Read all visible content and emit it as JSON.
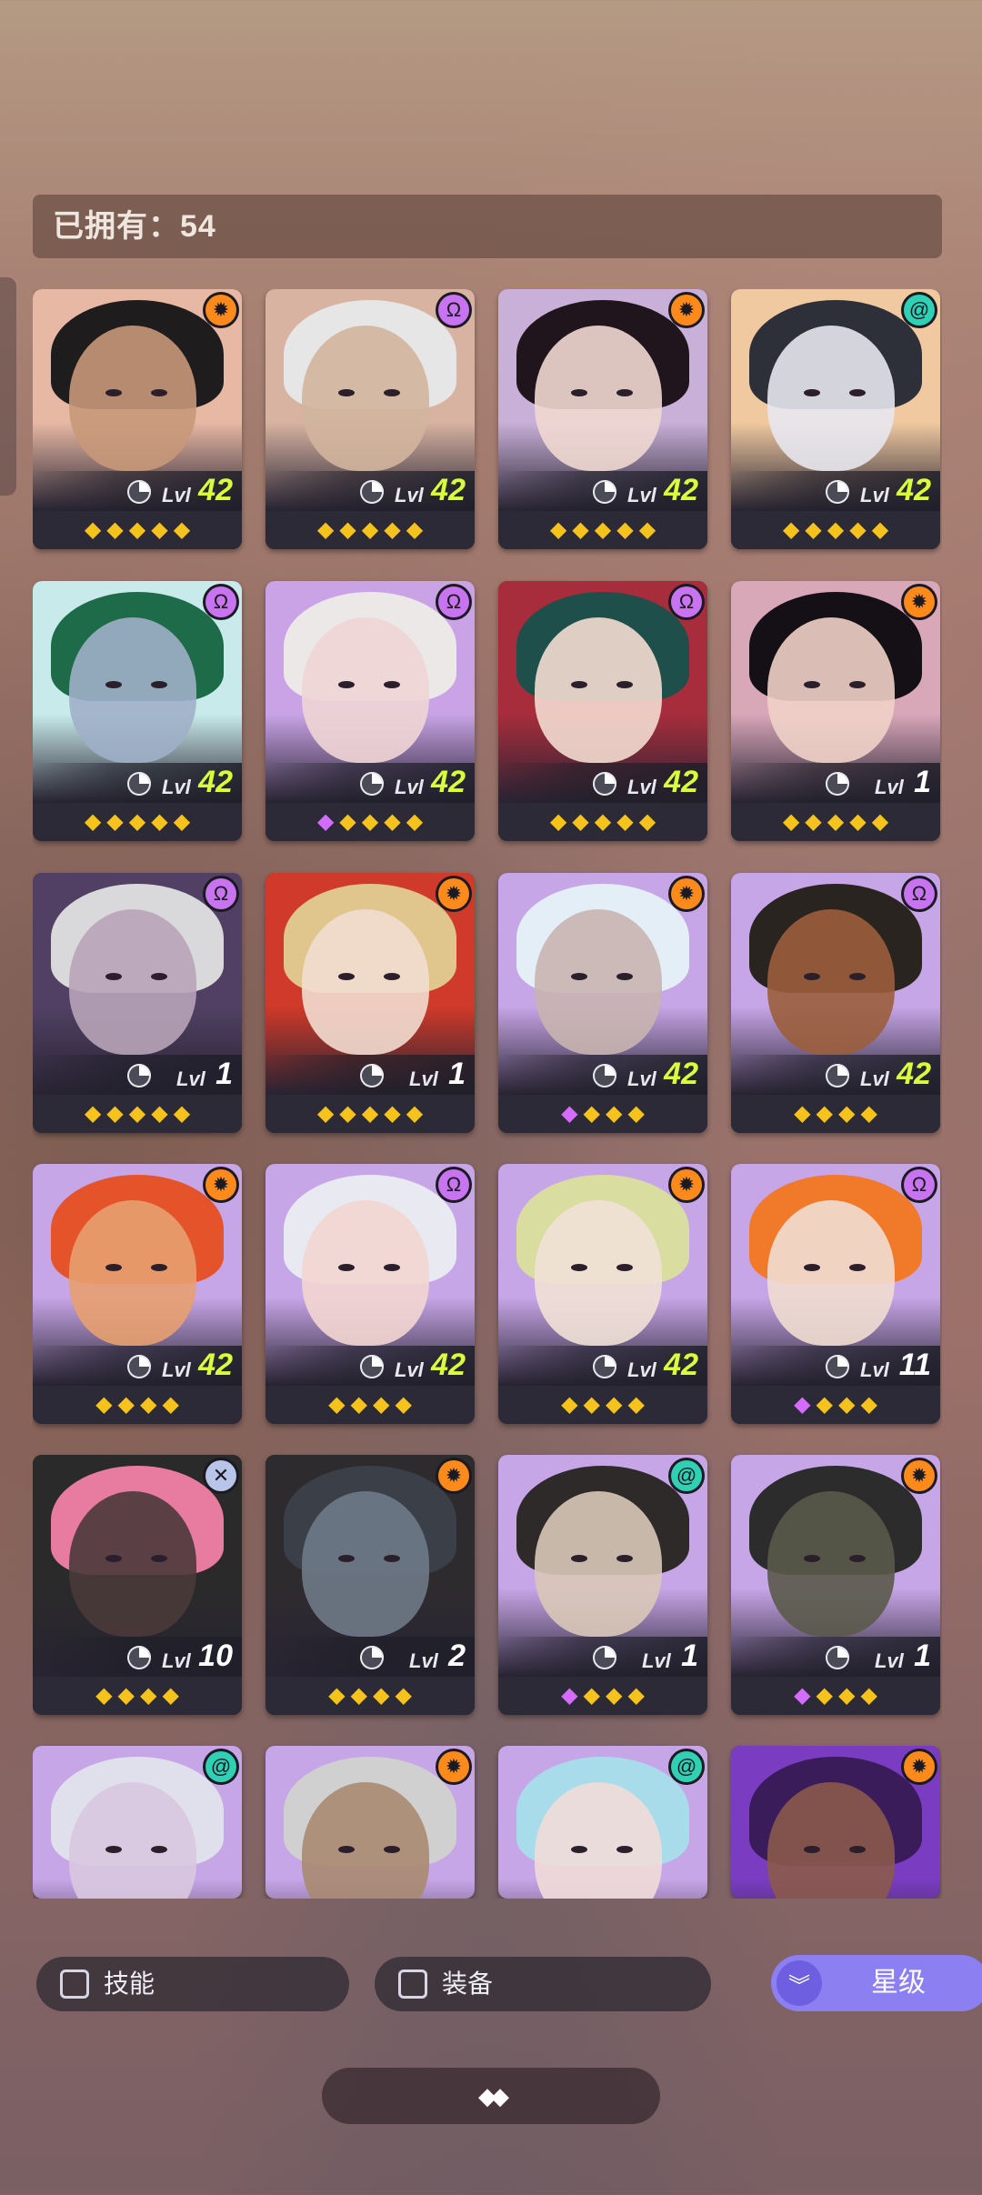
{
  "owned": {
    "label": "已拥有：54"
  },
  "level_prefix": "Lvl",
  "cards": [
    {
      "element": "orange",
      "level": "42",
      "stars": 5,
      "purple_stars": 0,
      "bg": "#e7b8a4",
      "hair": "#1f1c1e",
      "skin": "#c89879"
    },
    {
      "element": "purple",
      "level": "42",
      "stars": 5,
      "purple_stars": 0,
      "bg": "#d8b3a2",
      "hair": "#e6e6e6",
      "skin": "#d2b59d"
    },
    {
      "element": "orange",
      "level": "42",
      "stars": 5,
      "purple_stars": 0,
      "bg": "#c9b0d8",
      "hair": "#20151c",
      "skin": "#f0d8d0"
    },
    {
      "element": "teal",
      "level": "42",
      "stars": 5,
      "purple_stars": 0,
      "bg": "#f0c9a0",
      "hair": "#2d3038",
      "skin": "#e7e7ee"
    },
    {
      "element": "purple",
      "level": "42",
      "stars": 5,
      "purple_stars": 0,
      "bg": "#c8eaea",
      "hair": "#1e6b4a",
      "skin": "#9fb0c8"
    },
    {
      "element": "purple",
      "level": "42",
      "stars": 4,
      "purple_stars": 1,
      "bg": "#c9a3e6",
      "hair": "#ece8e8",
      "skin": "#f0d5d5"
    },
    {
      "element": "purple",
      "level": "42",
      "stars": 5,
      "purple_stars": 0,
      "bg": "#a82d3c",
      "hair": "#1e4f4a",
      "skin": "#f3dcd1"
    },
    {
      "element": "orange",
      "level": "1",
      "stars": 5,
      "purple_stars": 0,
      "bg": "#d8a7b8",
      "hair": "#141016",
      "skin": "#f0d2c8"
    },
    {
      "element": "purple",
      "level": "1",
      "stars": 5,
      "purple_stars": 0,
      "bg": "#514064",
      "hair": "#d9d9dc",
      "skin": "#b8a4b8"
    },
    {
      "element": "orange",
      "level": "1",
      "stars": 5,
      "purple_stars": 0,
      "bg": "#d03a2a",
      "hair": "#e0c58c",
      "skin": "#f2ddd0"
    },
    {
      "element": "orange",
      "level": "42",
      "stars": 3,
      "purple_stars": 1,
      "bg": "#c7a6e8",
      "hair": "#e3eef6",
      "skin": "#c8b4b0"
    },
    {
      "element": "purple",
      "level": "42",
      "stars": 4,
      "purple_stars": 0,
      "bg": "#c7a6e8",
      "hair": "#2a2420",
      "skin": "#9b5e3c"
    },
    {
      "element": "orange",
      "level": "42",
      "stars": 4,
      "purple_stars": 0,
      "bg": "#c7a6e8",
      "hair": "#e5532a",
      "skin": "#e7a070"
    },
    {
      "element": "purple",
      "level": "42",
      "stars": 4,
      "purple_stars": 0,
      "bg": "#c7a6e8",
      "hair": "#e9e9f2",
      "skin": "#f3d6d0"
    },
    {
      "element": "orange",
      "level": "42",
      "stars": 4,
      "purple_stars": 0,
      "bg": "#c7a6e8",
      "hair": "#d9dda0",
      "skin": "#f1e1d6"
    },
    {
      "element": "purple",
      "level": "11",
      "stars": 3,
      "purple_stars": 1,
      "bg": "#c7a6e8",
      "hair": "#f07a2a",
      "skin": "#f0ddd0"
    },
    {
      "element": "grey",
      "level": "10",
      "stars": 4,
      "purple_stars": 0,
      "bg": "#2a2a2a",
      "hair": "#e87ca0",
      "skin": "#4a3a3a"
    },
    {
      "element": "orange",
      "level": "2",
      "stars": 4,
      "purple_stars": 0,
      "bg": "#2e2b2f",
      "hair": "#3b3f47",
      "skin": "#6f7a88"
    },
    {
      "element": "teal",
      "level": "1",
      "stars": 3,
      "purple_stars": 1,
      "bg": "#c7a6e8",
      "hair": "#2e2a2a",
      "skin": "#d9c8b8"
    },
    {
      "element": "orange",
      "level": "1",
      "stars": 3,
      "purple_stars": 1,
      "bg": "#c7a6e8",
      "hair": "#2c2c2c",
      "skin": "#5a5a4a"
    },
    {
      "element": "teal",
      "level": "",
      "stars": 0,
      "purple_stars": 0,
      "bg": "#c7a6e8",
      "hair": "#e0e0ec",
      "skin": "#d8c8e0"
    },
    {
      "element": "orange",
      "level": "",
      "stars": 0,
      "purple_stars": 0,
      "bg": "#c7a6e8",
      "hair": "#d0d0d0",
      "skin": "#a88a70"
    },
    {
      "element": "teal",
      "level": "",
      "stars": 0,
      "purple_stars": 0,
      "bg": "#c7a6e8",
      "hair": "#a8dcea",
      "skin": "#f0dcd8"
    },
    {
      "element": "orange",
      "level": "",
      "stars": 0,
      "purple_stars": 0,
      "bg": "#7a3cc0",
      "hair": "#3a1c5a",
      "skin": "#8a5a4a"
    }
  ],
  "filters": {
    "skill_label": "技能",
    "equip_label": "装备"
  },
  "sort": {
    "label": "星级"
  },
  "icons": {
    "element_orange": "sun-gear-icon",
    "element_purple": "omega-icon",
    "element_teal": "swirl-icon",
    "element_grey": "cross-icon",
    "collapse": "chevrons-icon"
  }
}
